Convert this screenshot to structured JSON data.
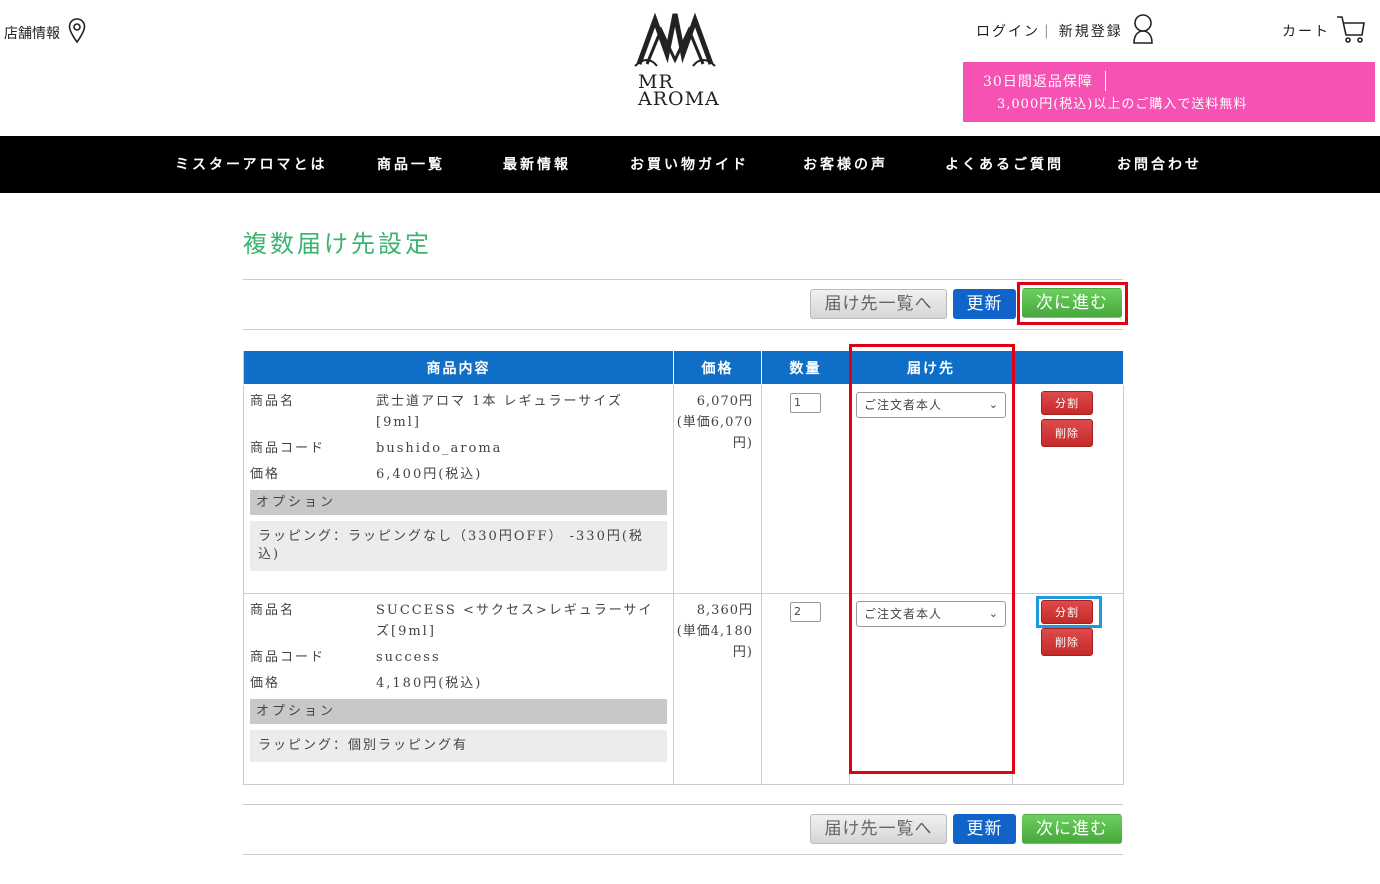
{
  "header": {
    "store_info": "店舗情報",
    "logo_line1": "MR",
    "logo_line2": "AROMA",
    "login": "ログイン",
    "register": "新規登録",
    "cart": "カート",
    "promo_line1": "30日間返品保障",
    "promo_line2": "3,000円(税込)以上のご購入で送料無料"
  },
  "nav": {
    "items": [
      "ミスターアロマとは",
      "商品一覧",
      "最新情報",
      "お買い物ガイド",
      "お客様の声",
      "よくあるご質問",
      "お問合わせ"
    ]
  },
  "page": {
    "title": "複数届け先設定"
  },
  "buttons": {
    "list": "届け先一覧へ",
    "update": "更新",
    "next": "次に進む",
    "split": "分割",
    "delete": "削除"
  },
  "table": {
    "headers": [
      "商品内容",
      "価格",
      "数量",
      "届け先",
      ""
    ],
    "label_name": "商品名",
    "label_code": "商品コード",
    "label_price": "価格",
    "label_option": "オプション",
    "rows": [
      {
        "name": "武士道アロマ 1本 レギュラーサイズ[9ml]",
        "code": "bushido_aroma",
        "price": "6,400円(税込)",
        "option": "ラッピング：ラッピングなし（330円OFF） -330円(税込)",
        "subtotal": "6,070円",
        "unit": "(単価6,070円)",
        "qty": "1",
        "destination": "ご注文者本人"
      },
      {
        "name": "SUCCESS <サクセス>レギュラーサイズ[9ml]",
        "code": "success",
        "price": "4,180円(税込)",
        "option": "ラッピング：個別ラッピング有",
        "subtotal": "8,360円",
        "unit": "(単価4,180円)",
        "qty": "2",
        "destination": "ご注文者本人"
      }
    ]
  },
  "colors": {
    "title_green": "#3cb371",
    "header_blue": "#0f6fc6",
    "promo_pink": "#f652b3",
    "highlight_red": "#e00012",
    "highlight_blue": "#1a9be0"
  }
}
